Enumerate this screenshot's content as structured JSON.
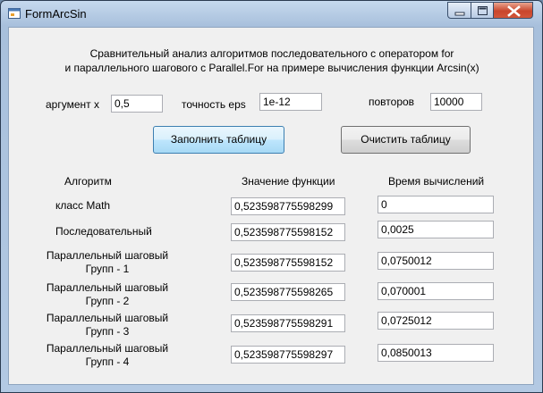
{
  "window": {
    "title": "FormArcSin"
  },
  "heading": {
    "line1": "Сравнительный анализ алгоритмов последовательного с оператором for",
    "line2": "и параллельного шагового с Parallel.For на примере вычисления функции Arcsin(x)"
  },
  "params": {
    "arg_label": "аргумент x",
    "arg_value": "0,5",
    "eps_label": "точность eps",
    "eps_value": "1e-12",
    "repeat_label": "повторов",
    "repeat_value": "10000"
  },
  "buttons": {
    "fill": "Заполнить таблицу",
    "clear": "Очистить таблицу"
  },
  "table": {
    "headers": [
      "Алгоритм",
      "Значение функции",
      "Время вычислений"
    ],
    "rows": [
      {
        "name1": "класс Math",
        "name2": "",
        "value": "0,523598775598299",
        "time": "0"
      },
      {
        "name1": "Последовательный",
        "name2": "",
        "value": "0,523598775598152",
        "time": "0,0025"
      },
      {
        "name1": "Параллельный шаговый",
        "name2": "Групп - 1",
        "value": "0,523598775598152",
        "time": "0,0750012"
      },
      {
        "name1": "Параллельный шаговый",
        "name2": "Групп - 2",
        "value": "0,523598775598265",
        "time": "0,070001"
      },
      {
        "name1": "Параллельный шаговый",
        "name2": "Групп - 3",
        "value": "0,523598775598291",
        "time": "0,0725012"
      },
      {
        "name1": "Параллельный шаговый",
        "name2": "Групп - 4",
        "value": "0,523598775598297",
        "time": "0,0850013"
      }
    ]
  },
  "colors": {
    "title_bar": "#b3c9e3",
    "client_bg": "#f0f0f0",
    "close_button": "#c9462c",
    "focused_button": "#bee6fd"
  },
  "icons": {
    "app": "form-icon",
    "minimize": "minimize-icon",
    "maximize": "maximize-icon",
    "close": "close-icon"
  }
}
